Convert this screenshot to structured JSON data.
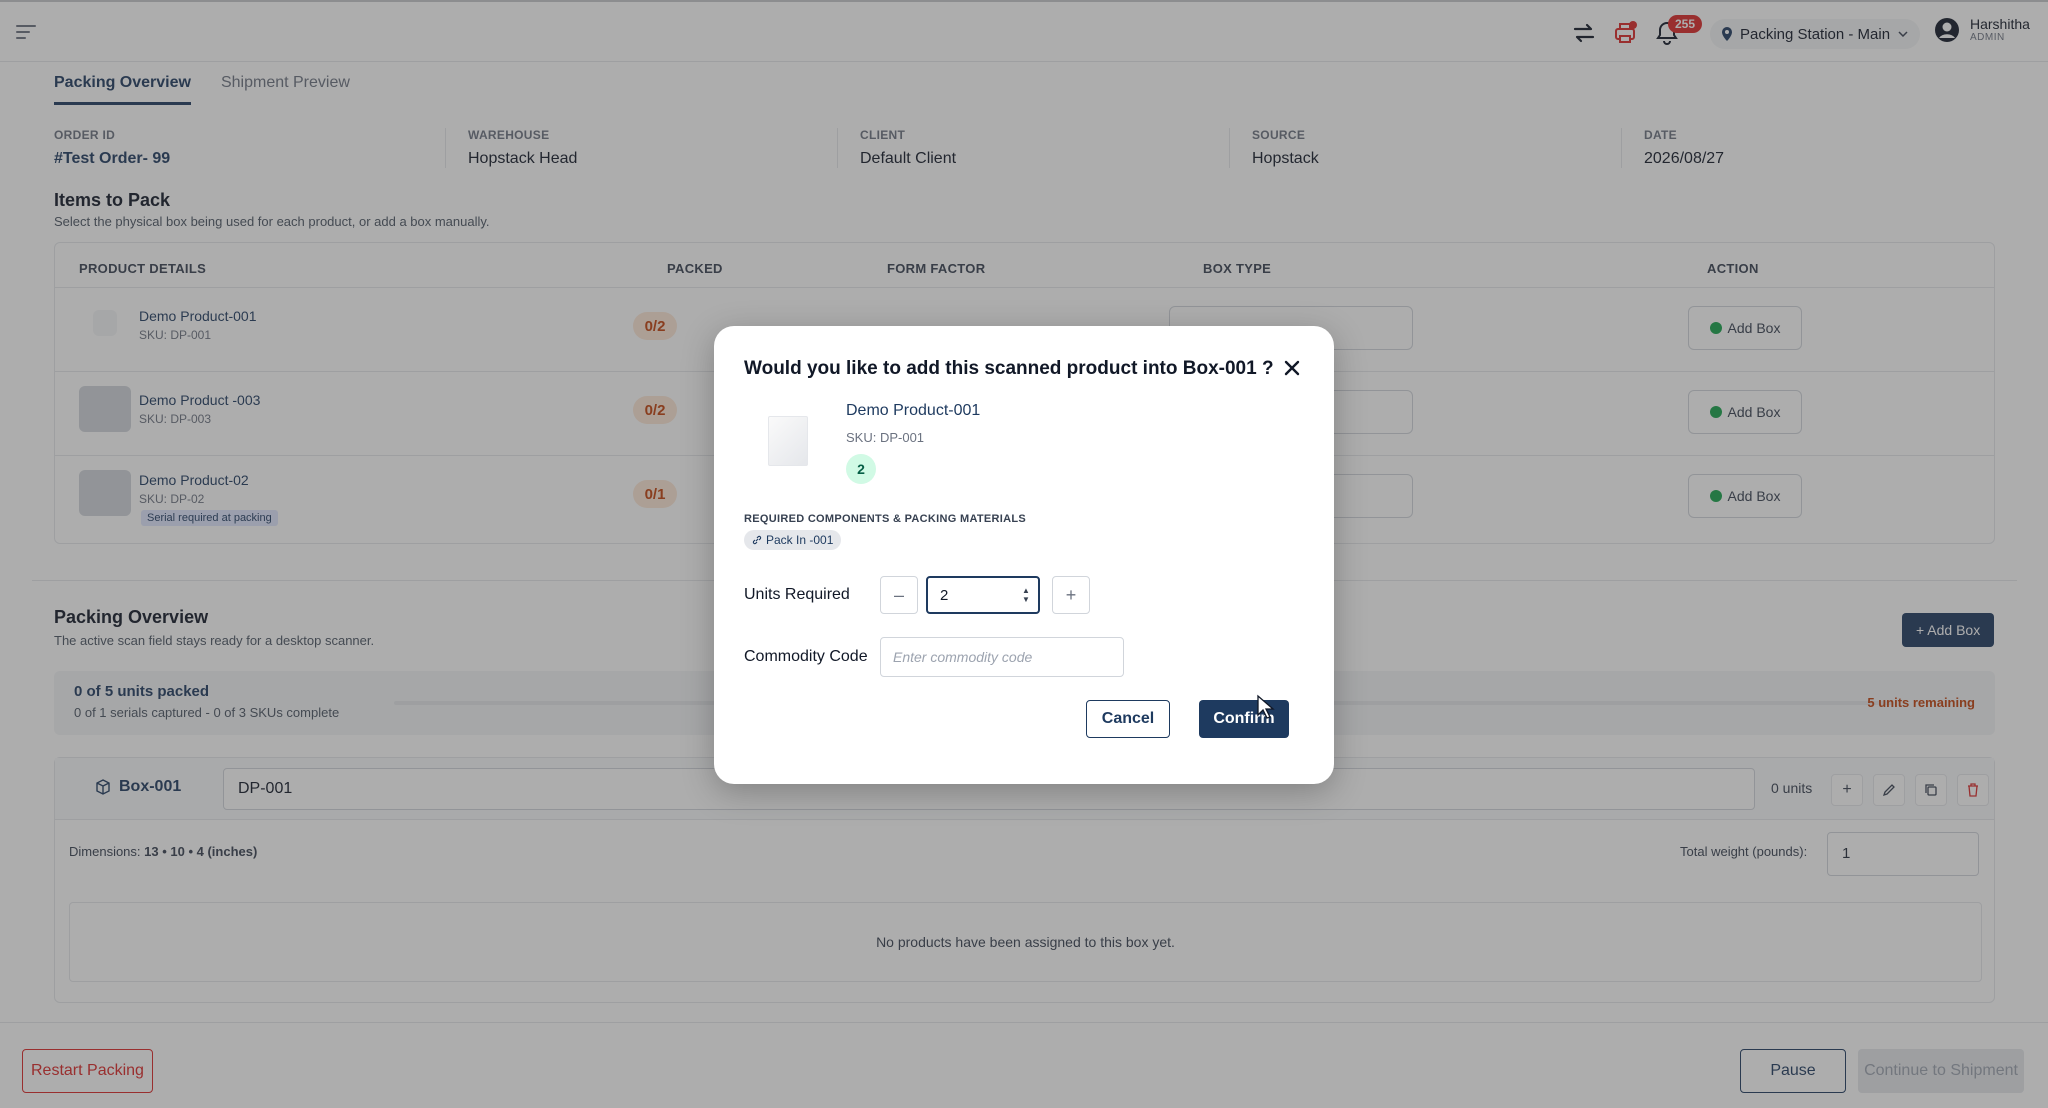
{
  "topbar": {
    "notification_count": "255",
    "station": "Packing Station - Main",
    "user_name": "Harshitha",
    "user_role": "ADMIN"
  },
  "tabs": [
    "Packing Overview",
    "Shipment Preview"
  ],
  "meta": {
    "order_id": {
      "label": "ORDER ID",
      "value": "#Test Order- 99"
    },
    "warehouse": {
      "label": "WAREHOUSE",
      "value": "Hopstack Head"
    },
    "client": {
      "label": "CLIENT",
      "value": "Default Client"
    },
    "source": {
      "label": "SOURCE",
      "value": "Hopstack"
    },
    "date": {
      "label": "DATE",
      "value": "2026/08/27"
    }
  },
  "items_section": {
    "title": "Items to Pack",
    "subtitle": "Select the physical box being used for each product, or add a box manually.",
    "headers": [
      "PRODUCT DETAILS",
      "PACKED",
      "FORM FACTOR",
      "BOX TYPE",
      "ACTION"
    ],
    "rows": [
      {
        "name": "Demo Product-001",
        "sku": "SKU: DP-001",
        "packed": "0/2",
        "action": "Add Box"
      },
      {
        "name": "Demo Product -003",
        "sku": "SKU: DP-003",
        "packed": "0/2",
        "action": "Add Box"
      },
      {
        "name": "Demo Product-02",
        "sku": "SKU: DP-02",
        "serial": "Serial required at packing",
        "packed": "0/1",
        "action": "Add Box"
      }
    ]
  },
  "overview": {
    "title": "Packing Overview",
    "subtitle": "The active scan field stays ready for a desktop scanner.",
    "add_box": "+ Add Box",
    "progress_title": "0 of 5 units packed",
    "progress_sub": "0 of 1 serials captured - 0 of 3 SKUs complete",
    "progress_fraction": 0,
    "remaining": "5 units remaining",
    "box": {
      "label": "Box-001",
      "scan_value": "DP-001",
      "units": "0 units",
      "dims_label": "Dimensions:",
      "dims_value": "13 • 10 • 4 (inches)",
      "weight_label": "Total weight (pounds):",
      "weight_value": "1",
      "empty_text": "No products have been assigned to this box yet."
    }
  },
  "footer": {
    "restart": "Restart Packing",
    "pause": "Pause",
    "continue": "Continue to Shipment"
  },
  "modal": {
    "title": "Would you like to add this scanned product into Box-001 ?",
    "product_name": "Demo Product-001",
    "product_sku": "SKU: DP-001",
    "count": "2",
    "req_label": "REQUIRED COMPONENTS & PACKING MATERIALS",
    "chip": "Pack In -001",
    "units_label": "Units Required",
    "units_value": "2",
    "commodity_label": "Commodity Code",
    "commodity_placeholder": "Enter commodity code",
    "cancel": "Cancel",
    "confirm": "Confirm"
  },
  "colors": {
    "primary": "#1e3a5f",
    "danger": "#dc2626",
    "warning": "#c2410c",
    "success": "#16a34a"
  }
}
